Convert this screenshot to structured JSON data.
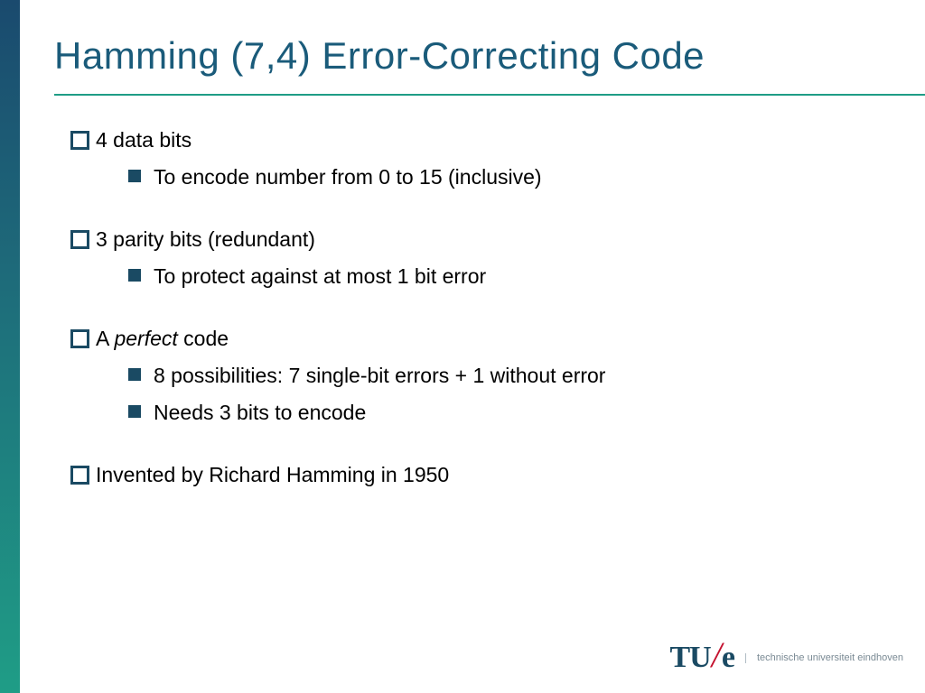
{
  "title": "Hamming (7,4) Error-Correcting Code",
  "bullets": {
    "b1": "4 data bits",
    "b1a": "To encode number from 0 to 15 (inclusive)",
    "b2": "3 parity bits (redundant)",
    "b2a": "To protect against at most 1 bit error",
    "b3_pre": "A ",
    "b3_em": "perfect",
    "b3_post": " code",
    "b3a": "8 possibilities: 7 single-bit errors + 1 without error",
    "b3b": "Needs 3 bits to encode",
    "b4": "Invented by Richard Hamming in 1950"
  },
  "footer": {
    "tu": "TU",
    "e": "e",
    "uni": "technische universiteit eindhoven"
  }
}
